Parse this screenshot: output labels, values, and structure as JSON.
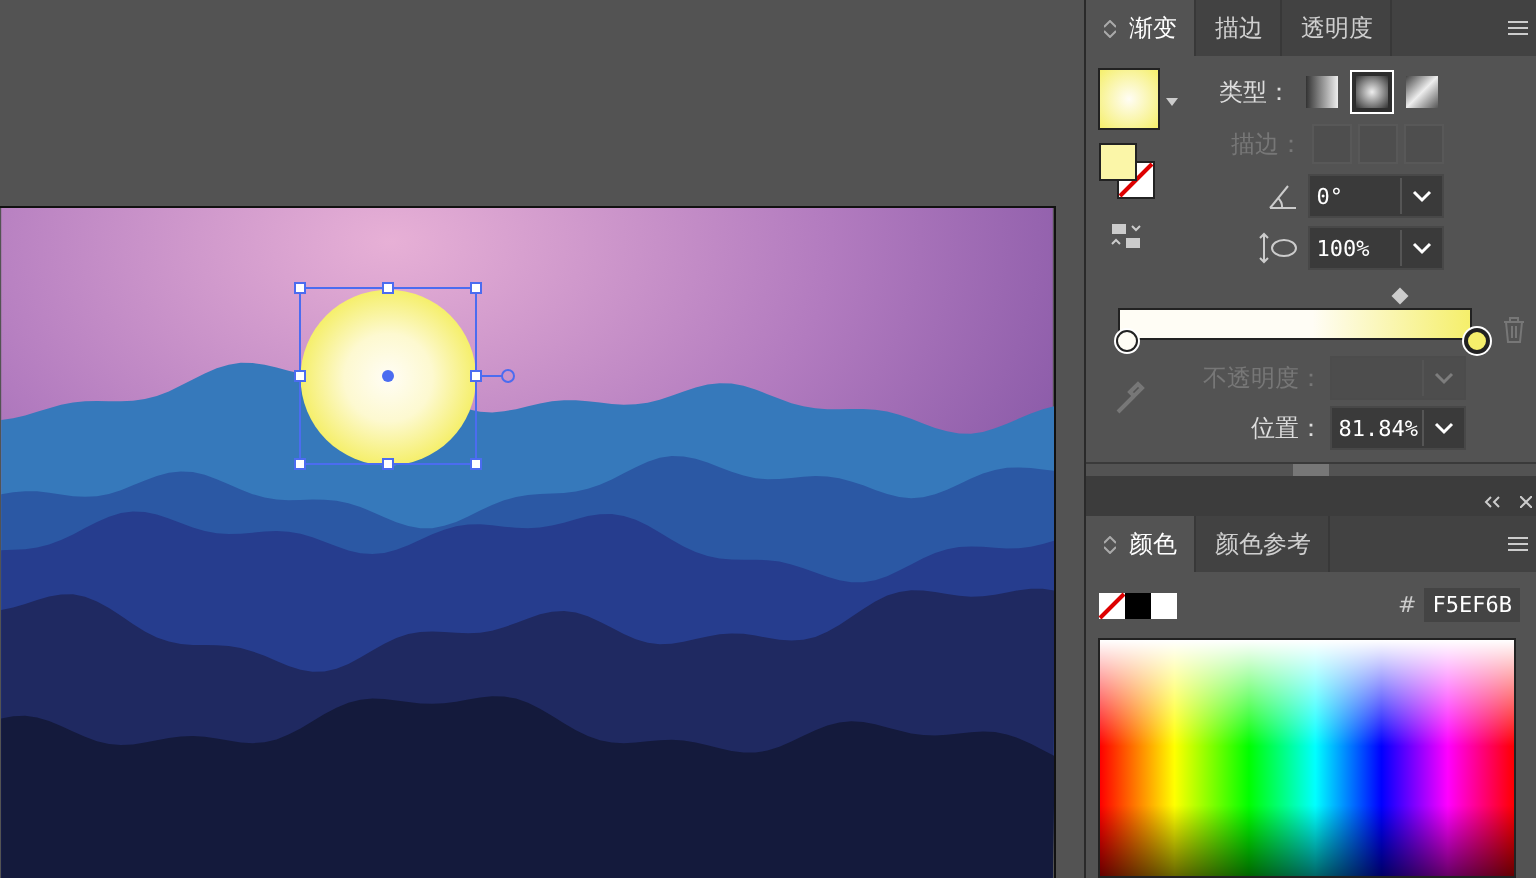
{
  "gradient_panel": {
    "tabs": [
      {
        "label": "渐变",
        "selected": true
      },
      {
        "label": "描边",
        "selected": false
      },
      {
        "label": "透明度",
        "selected": false
      }
    ],
    "type_label": "类型：",
    "types": [
      {
        "kind": "linear",
        "selected": false
      },
      {
        "kind": "radial",
        "selected": true
      },
      {
        "kind": "freeform",
        "selected": false
      }
    ],
    "stroke_label": "描边：",
    "stroke_disabled": true,
    "angle": "0°",
    "aspect": "100%",
    "stops": [
      {
        "color": "#fffdf5",
        "selected": false
      },
      {
        "color": "#f5ef6b",
        "selected": true
      }
    ],
    "opacity_label": "不透明度：",
    "opacity_disabled": true,
    "location_label": "位置：",
    "location": "81.84%"
  },
  "color_panel": {
    "tabs": [
      {
        "label": "颜色",
        "selected": true
      },
      {
        "label": "颜色参考",
        "selected": false
      }
    ],
    "hex_label": "#",
    "hex": "F5EF6B"
  }
}
